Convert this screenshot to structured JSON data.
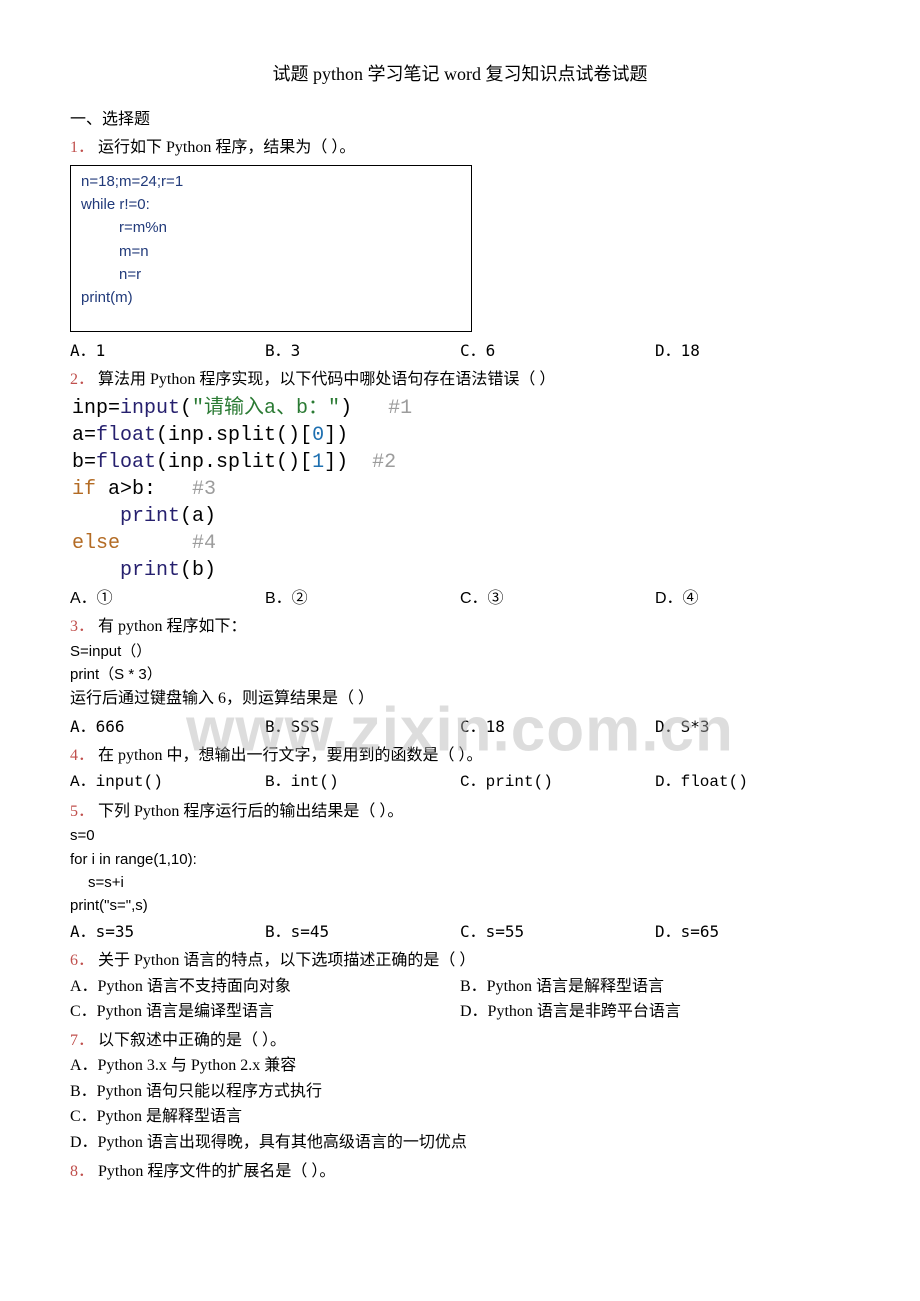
{
  "title": "试题 python 学习笔记 word 复习知识点试卷试题",
  "section1": "一、选择题",
  "watermark": "www.zixin.com.cn",
  "q1": {
    "prompt": "运行如下 Python 程序，结果为（  ）。",
    "code": [
      "n=18;m=24;r=1",
      "while r!=0:",
      "r=m%n",
      "m=n",
      "n=r",
      "print(m)"
    ],
    "opts": {
      "A": "A．1",
      "B": "B．3",
      "C": "C．6",
      "D": "D．18"
    }
  },
  "q2": {
    "prompt": "算法用 Python 程序实现，以下代码中哪处语句存在语法错误（  ）",
    "opts": {
      "A": "A．①",
      "B": "B．②",
      "C": "C．③",
      "D": "D．④"
    },
    "code_lines": {
      "l1a": "inp=",
      "l1b": "input",
      "l1c": "(",
      "l1d": "\"请输入a、b：\"",
      "l1e": ")   ",
      "l1f": "#1",
      "l2a": "a=",
      "l2b": "float",
      "l2c": "(inp.split()[",
      "l2d": "0",
      "l2e": "])",
      "l3a": "b=",
      "l3b": "float",
      "l3c": "(inp.split()[",
      "l3d": "1",
      "l3e": "])  ",
      "l3f": "#2",
      "l4a": "if",
      "l4b": " a>b:   ",
      "l4c": "#3",
      "l5a": "    ",
      "l5b": "print",
      "l5c": "(a)",
      "l6a": "else",
      "l6b": "      ",
      "l6c": "#4",
      "l7a": "    ",
      "l7b": "print",
      "l7c": "(b)"
    }
  },
  "q3": {
    "prompt": "有 python 程序如下：",
    "code": [
      "S=input（）",
      "print（S * 3）"
    ],
    "sub": "运行后通过键盘输入 6，则运算结果是（  ）",
    "opts": {
      "A": "A．666",
      "B": "B．SSS",
      "C": "C．18",
      "D": "D．S*3"
    }
  },
  "q4": {
    "prompt": "在 python 中，想输出一行文字，要用到的函数是（    ）。",
    "opts": {
      "A": "A．input()",
      "B": "B．int()",
      "C": "C．print()",
      "D": "D．float()"
    }
  },
  "q5": {
    "prompt": "下列 Python 程序运行后的输出结果是（  ）。",
    "code": [
      "s=0",
      "for i in range(1,10):",
      "s=s+i",
      "print(\"s=\",s)"
    ],
    "opts": {
      "A": "A．s=35",
      "B": "B．s=45",
      "C": "C．s=55",
      "D": "D．s=65"
    }
  },
  "q6": {
    "prompt": "关于 Python 语言的特点，以下选项描述正确的是（  ）",
    "opts": {
      "A": "A．Python 语言不支持面向对象",
      "B": "B．Python 语言是解释型语言",
      "C": "C．Python 语言是编译型语言",
      "D": "D．Python 语言是非跨平台语言"
    }
  },
  "q7": {
    "prompt": "以下叙述中正确的是（    ）。",
    "opts": {
      "A": "A．Python 3.x 与 Python 2.x 兼容",
      "B": "B．Python 语句只能以程序方式执行",
      "C": "C．Python 是解释型语言",
      "D": "D．Python 语言出现得晚，具有其他高级语言的一切优点"
    }
  },
  "q8": {
    "prompt": "Python 程序文件的扩展名是（    ）。"
  },
  "nums": {
    "1": "1．",
    "2": "2．",
    "3": "3．",
    "4": "4．",
    "5": "5．",
    "6": "6．",
    "7": "7．",
    "8": "8．"
  }
}
